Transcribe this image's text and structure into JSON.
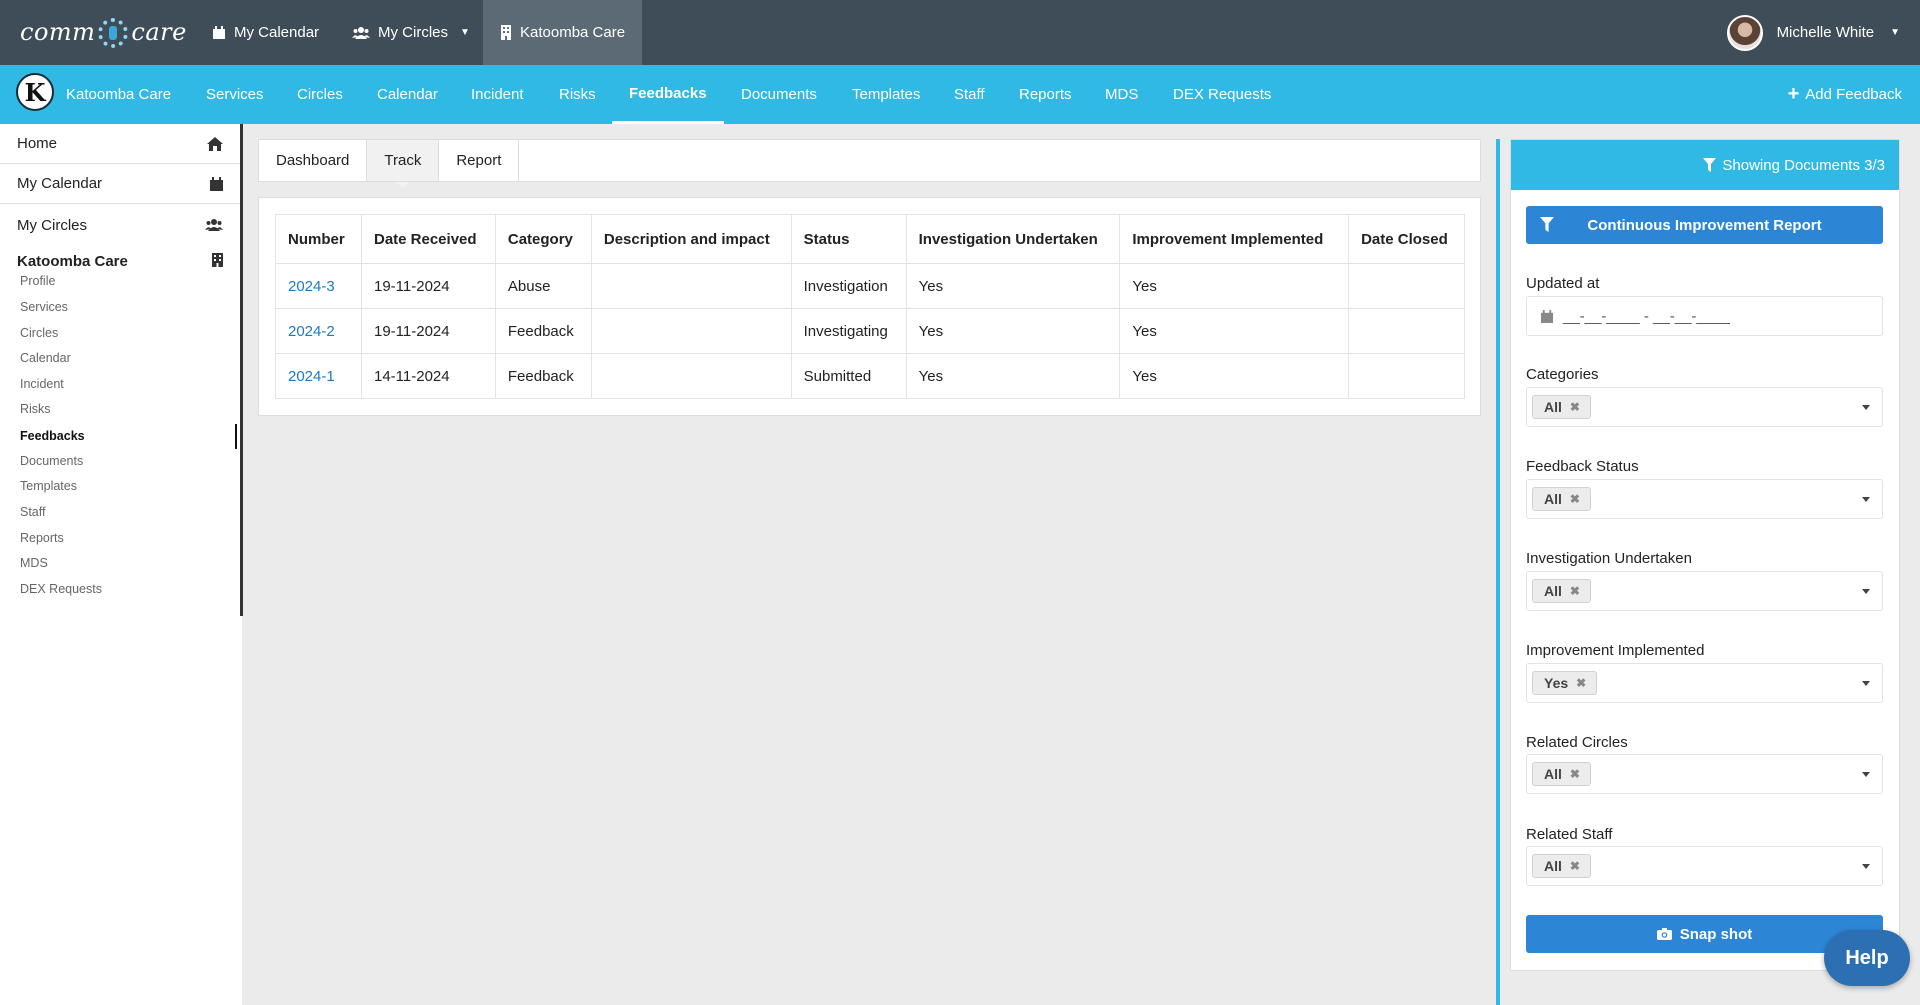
{
  "topbar": {
    "logo": "commcare",
    "my_calendar": "My Calendar",
    "my_circles": "My Circles",
    "org": "Katoomba Care",
    "user_name": "Michelle White"
  },
  "bluenav": {
    "org_initial": "K",
    "items": [
      "Katoomba Care",
      "Services",
      "Circles",
      "Calendar",
      "Incident",
      "Risks",
      "Feedbacks",
      "Documents",
      "Templates",
      "Staff",
      "Reports",
      "MDS",
      "DEX Requests"
    ],
    "active": "Feedbacks",
    "add_feedback": "Add Feedback"
  },
  "sidebar": {
    "home": "Home",
    "my_calendar": "My Calendar",
    "my_circles": "My Circles",
    "org": "Katoomba Care",
    "sub_items": [
      "Profile",
      "Services",
      "Circles",
      "Calendar",
      "Incident",
      "Risks",
      "Feedbacks",
      "Documents",
      "Templates",
      "Staff",
      "Reports",
      "MDS",
      "DEX Requests"
    ],
    "active_sub": "Feedbacks"
  },
  "tabs": [
    "Dashboard",
    "Track",
    "Report"
  ],
  "active_tab": "Track",
  "table": {
    "columns": [
      "Number",
      "Date Received",
      "Category",
      "Description and impact",
      "Status",
      "Investigation Undertaken",
      "Improvement Implemented",
      "Date Closed"
    ],
    "rows": [
      [
        "2024-3",
        "19-11-2024",
        "Abuse",
        "",
        "Investigation",
        "Yes",
        "Yes",
        ""
      ],
      [
        "2024-2",
        "19-11-2024",
        "Feedback",
        "",
        "Investigating",
        "Yes",
        "Yes",
        ""
      ],
      [
        "2024-1",
        "14-11-2024",
        "Feedback",
        "",
        "Submitted",
        "Yes",
        "Yes",
        ""
      ]
    ]
  },
  "filters": {
    "header": "Showing Documents 3/3",
    "report_button": "Continuous Improvement Report",
    "updated_at_label": "Updated at",
    "date_placeholder": "__-__-____ - __-__-____",
    "fields": [
      {
        "label": "Categories",
        "value": "All"
      },
      {
        "label": "Feedback Status",
        "value": "All"
      },
      {
        "label": "Investigation Undertaken",
        "value": "All"
      },
      {
        "label": "Improvement Implemented",
        "value": "Yes"
      },
      {
        "label": "Related Circles",
        "value": "All"
      },
      {
        "label": "Related Staff",
        "value": "All"
      }
    ],
    "snapshot_button": "Snap shot"
  },
  "help": "Help",
  "colors": {
    "topbar": "#3f4d58",
    "nav": "#30b9e5",
    "button": "#2d86d5",
    "link": "#1d79c4"
  }
}
